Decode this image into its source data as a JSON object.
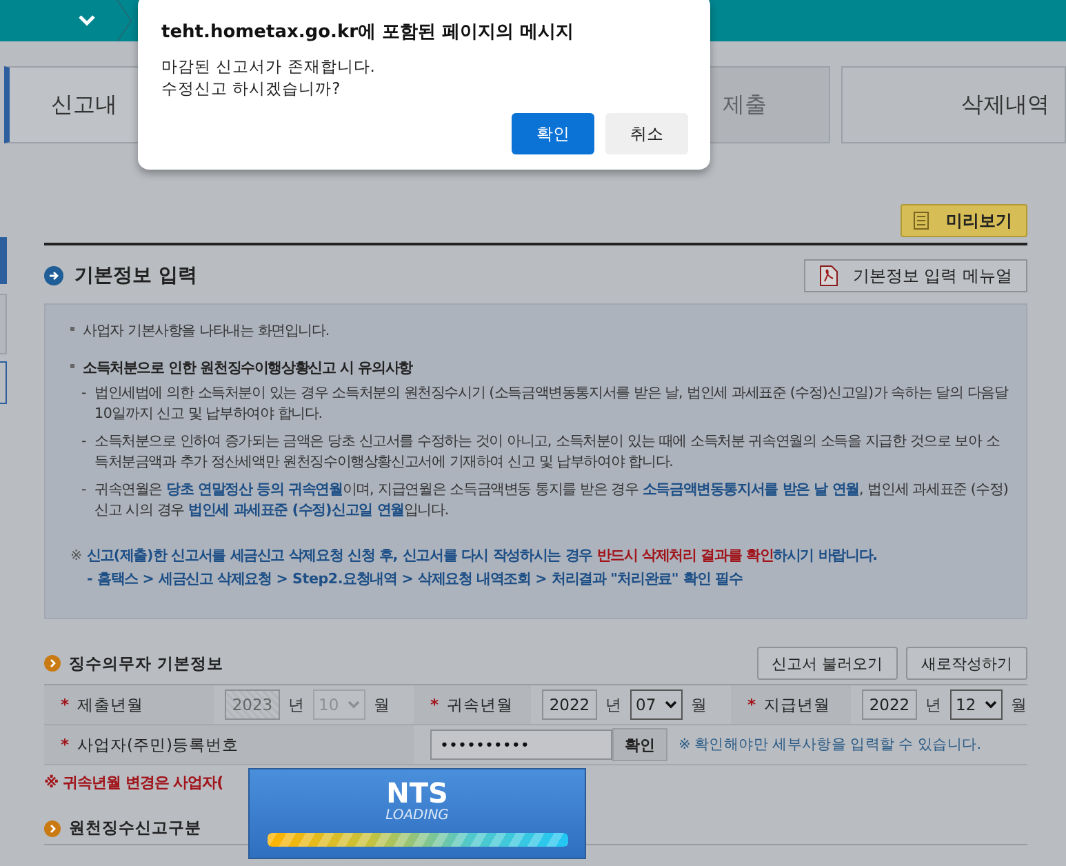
{
  "tabs": [
    {
      "label": "신고내",
      "selected": true,
      "disabled": false
    },
    {
      "label": "제출",
      "selected": false,
      "disabled": true
    },
    {
      "label": "삭제내역",
      "selected": false,
      "disabled": false
    }
  ],
  "preview_button": "미리보기",
  "section_title": "기본정보 입력",
  "manual_button": "기본정보 입력 메뉴얼",
  "notice": {
    "intro": "사업자 기본사항을 나타내는 화면입니다.",
    "heading": "소득처분으로 인한 원천징수이행상황신고 시 유의사항",
    "items": [
      {
        "marker": "-",
        "text": "법인세법에 의한 소득처분이 있는 경우 소득처분의 원천징수시기 (소득금액변동통지서를 받은 날, 법인세 과세표준 (수정)신고일)가 속하는 달의 다음달 10일까지 신고 및 납부하여야 합니다."
      },
      {
        "marker": "-",
        "text": "소득처분으로 인하여 증가되는 금액은 당초 신고서를 수정하는 것이 아니고, 소득처분이 있는 때에 소득처분 귀속연월의 소득을 지급한 것으로 보아 소득처분금액과 추가 정산세액만 원천징수이행상황신고서에 기재하여 신고 및 납부하여야 합니다."
      },
      {
        "marker": "-",
        "text": "귀속연월은 **당초 연말정산 등의 귀속연월**이며, 지급연월은 소득금액변동 통지를 받은 경우 **소득금액변동통지서를 받은 날 연월**, 법인세 과세표준 (수정)신고 시의 경우 **법인세 과세표준 (수정)신고일 연월**입니다."
      }
    ],
    "warning": {
      "mark": "※",
      "text": "신고(제출)한 신고서를 세금신고 삭제요청 신청 후, 신고서를 다시 작성하시는 경우 ",
      "emphasis": "반드시 삭제처리 결과를 확인",
      "tail": "하시기 바랍니다."
    },
    "path": "- 홈택스 > 세금신고 삭제요청 > Step2.요청내역 > 삭제요청 내역조회 > 처리결과 \"처리완료\" 확인 필수"
  },
  "payer_info": {
    "title": "징수의무자 기본정보",
    "buttons": [
      "신고서 불러오기",
      "새로작성하기"
    ],
    "periods": [
      {
        "marker": "*",
        "label": "제출년월",
        "year": "2023",
        "year_unit": "년",
        "month": "10",
        "month_unit": "월",
        "disabled": true
      },
      {
        "marker": "*",
        "label": "귀속년월",
        "year": "2022",
        "year_unit": "년",
        "month": "07",
        "month_unit": "월",
        "disabled": false
      },
      {
        "marker": "*",
        "label": "지급년월",
        "year": "2022",
        "year_unit": "년",
        "month": "12",
        "month_unit": "월",
        "disabled": false
      }
    ],
    "registration": {
      "marker": "*",
      "label": "사업자(주민)등록번호",
      "value": "••••••••••",
      "button": "확인",
      "hint": "※ 확인해야만 세부사항을 입력할 수 있습니다."
    },
    "note": "※ 귀속년월 변경은 사업자("
  },
  "report_type": {
    "title": "원천징수신고구분"
  },
  "loading": {
    "title": "NTS",
    "caption": "LOADING",
    "level": 1
  },
  "dialog": {
    "title": "teht.hometax.go.kr에 포함된 페이지의 메시지",
    "message": [
      "마감된 신고서가 존재합니다.",
      "수정신고 하시겠습니까?"
    ],
    "buttons": [
      {
        "label": "확인",
        "primary": true
      },
      {
        "label": "취소",
        "primary": false
      }
    ]
  }
}
